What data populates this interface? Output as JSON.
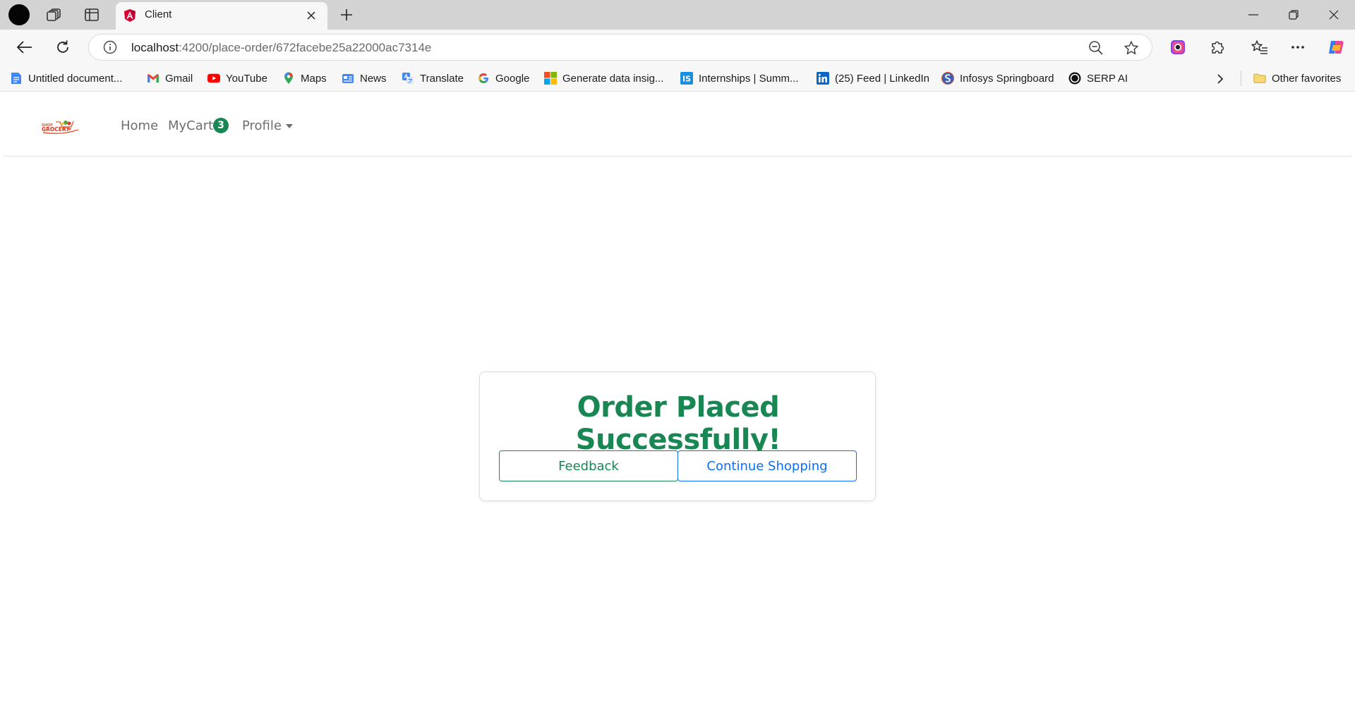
{
  "browser": {
    "tab": {
      "title": "Client",
      "favicon": "angular-icon"
    },
    "address": {
      "host": "localhost",
      "path": ":4200/place-order/672facebe25a22000ac7314e"
    },
    "bookmarks": [
      {
        "label": "Untitled document...",
        "icon": "google-docs-icon"
      },
      {
        "label": "Gmail",
        "icon": "gmail-icon"
      },
      {
        "label": "YouTube",
        "icon": "youtube-icon"
      },
      {
        "label": "Maps",
        "icon": "maps-icon"
      },
      {
        "label": "News",
        "icon": "news-icon"
      },
      {
        "label": "Translate",
        "icon": "translate-icon"
      },
      {
        "label": "Google",
        "icon": "google-icon"
      },
      {
        "label": "Generate data insig...",
        "icon": "microsoft-icon"
      },
      {
        "label": "Internships | Summ...",
        "icon": "internshala-icon"
      },
      {
        "label": "(25) Feed | LinkedIn",
        "icon": "linkedin-icon"
      },
      {
        "label": "Infosys Springboard",
        "icon": "springboard-icon"
      },
      {
        "label": "SERP AI",
        "icon": "serp-ai-icon"
      }
    ],
    "other_favorites": "Other favorites"
  },
  "navbar": {
    "brand_icon": "shop-grocery-logo",
    "home": "Home",
    "mycart": "MyCart",
    "cart_count": "3",
    "profile": "Profile"
  },
  "order": {
    "message": "Order Placed Successfully!",
    "feedback_label": "Feedback",
    "continue_label": "Continue Shopping"
  },
  "colors": {
    "success": "#198754",
    "primary": "#0d6efd",
    "tab_strip": "#d3d3d3",
    "toolbar": "#f7f7f7"
  }
}
